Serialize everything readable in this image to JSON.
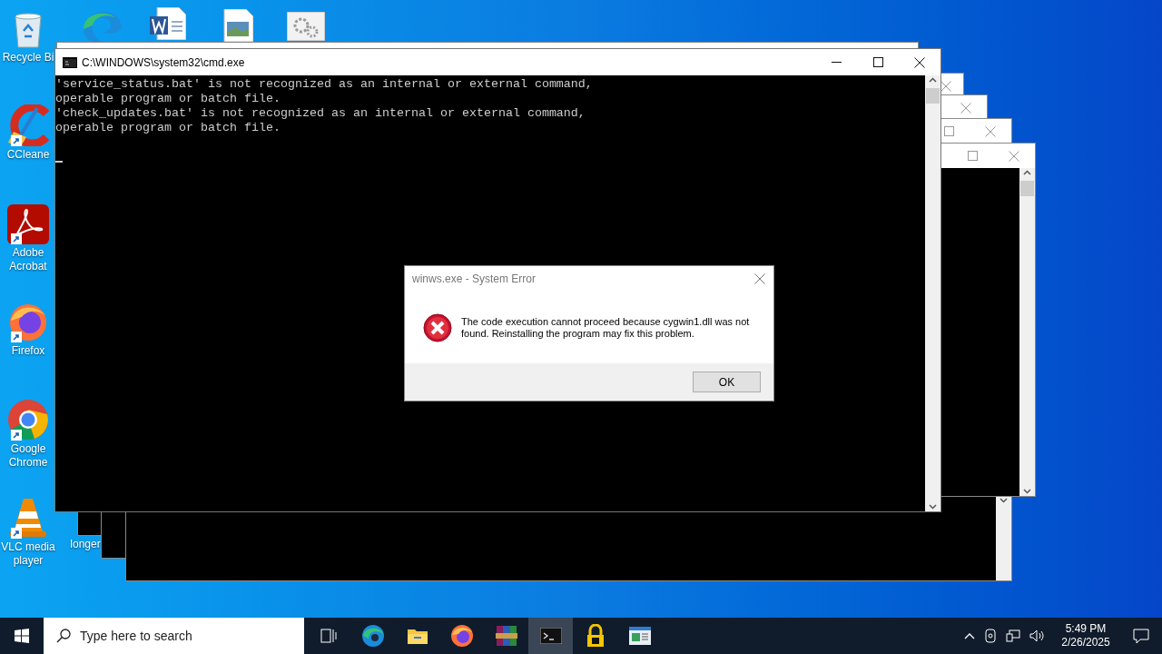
{
  "desktop_icons": [
    {
      "kind": "recycle-bin",
      "label": "Recycle Bi"
    },
    {
      "kind": "cleaner",
      "label": "CCleane",
      "shortcut": true
    },
    {
      "kind": "pdf",
      "label": "Adobe Acrobat",
      "shortcut": true
    },
    {
      "kind": "firefox",
      "label": "Firefox",
      "shortcut": true
    },
    {
      "kind": "chrome",
      "label": "Google Chrome",
      "shortcut": true
    },
    {
      "kind": "vlc",
      "label": "VLC media player",
      "shortcut": true
    },
    {
      "kind": "edge"
    },
    {
      "kind": "document"
    },
    {
      "kind": "image"
    },
    {
      "kind": "settings"
    },
    {
      "kind": "blank",
      "label": "longer"
    }
  ],
  "background_windows": [
    {
      "kind": "console"
    },
    {
      "kind": "console"
    },
    {
      "kind": "console"
    },
    {
      "kind": "console"
    },
    {
      "kind": "console"
    }
  ],
  "console_window": {
    "title": "C:\\WINDOWS\\system32\\cmd.exe",
    "lines": [
      "'service_status.bat' is not recognized as an internal or external command,",
      "operable program or batch file.",
      "'check_updates.bat' is not recognized as an internal or external command,",
      "operable program or batch file."
    ]
  },
  "error_dialog": {
    "title": "winws.exe - System Error",
    "message": "The code execution cannot proceed because cygwin1.dll was not found. Reinstalling the program may fix this problem.",
    "button": "OK"
  },
  "taskbar": {
    "search_placeholder": "Type here to search",
    "apps": [
      {
        "kind": "task-view",
        "selected": false
      },
      {
        "kind": "edge",
        "selected": false
      },
      {
        "kind": "folder",
        "selected": false
      },
      {
        "kind": "firefox",
        "selected": false
      },
      {
        "kind": "archive",
        "selected": false
      },
      {
        "kind": "terminal",
        "selected": true
      },
      {
        "kind": "lock",
        "selected": false
      },
      {
        "kind": "window",
        "selected": false
      }
    ],
    "time": "5:49 PM",
    "date": "2/26/2025"
  }
}
